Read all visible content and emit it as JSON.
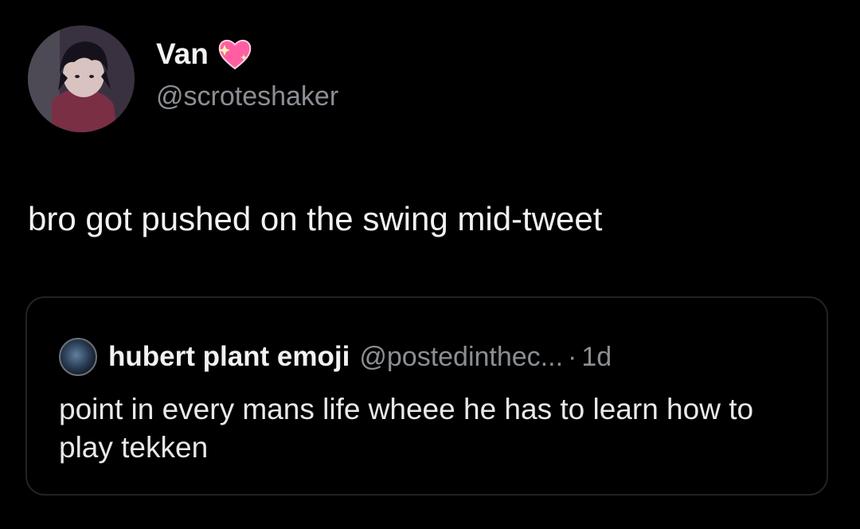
{
  "tweet": {
    "display_name": "Van",
    "name_emoji": "sparkling-heart-icon",
    "handle": "@scroteshaker",
    "text": "bro got pushed on the swing mid-tweet"
  },
  "quote": {
    "display_name": "hubert plant emoji",
    "handle": "@postedinthec...",
    "separator": "·",
    "time": "1d",
    "text": "point in every mans life wheee he has to learn how to play tekken"
  },
  "colors": {
    "background": "#000000",
    "primary_text": "#f2f2f2",
    "secondary_text": "#8b8f94",
    "quote_border": "#202327",
    "heart": "#ff5fa2"
  }
}
